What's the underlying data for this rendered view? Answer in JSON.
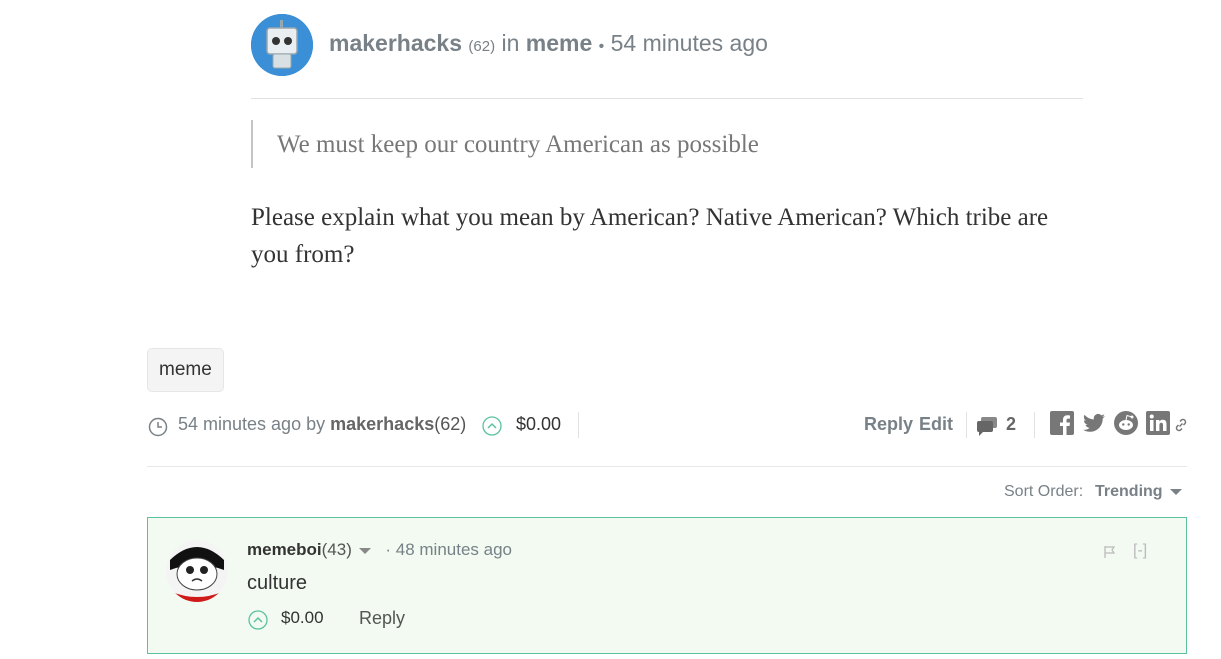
{
  "post": {
    "author": "makerhacks",
    "reputation": "(62)",
    "in_label": "in",
    "category": "meme",
    "bullet": "•",
    "time": "54 minutes ago"
  },
  "body": {
    "quote": "We must keep our country American as possible",
    "paragraph": "Please explain what you mean by American? Native American? Which tribe are you from?"
  },
  "tags": [
    "meme"
  ],
  "footer": {
    "time": "54 minutes ago",
    "by_label": "by",
    "author": "makerhacks",
    "reputation": "(62)",
    "payout": "$0.00",
    "reply_label": "Reply",
    "edit_label": "Edit",
    "comment_count": "2",
    "share_icons": [
      "facebook-icon",
      "twitter-icon",
      "reddit-icon",
      "linkedin-icon",
      "link-icon"
    ]
  },
  "sort": {
    "label": "Sort Order:",
    "value": "Trending"
  },
  "comments": [
    {
      "author": "memeboi",
      "reputation": "(43)",
      "separator": "·",
      "time": "48 minutes ago",
      "body": "culture",
      "payout": "$0.00",
      "reply_label": "Reply",
      "collapse_label": "[-]"
    }
  ],
  "colors": {
    "accent": "#5bc2a0",
    "comment_bg": "#f2faf2",
    "muted_text": "#788187",
    "avatar_bg": "#3a8fd6"
  }
}
